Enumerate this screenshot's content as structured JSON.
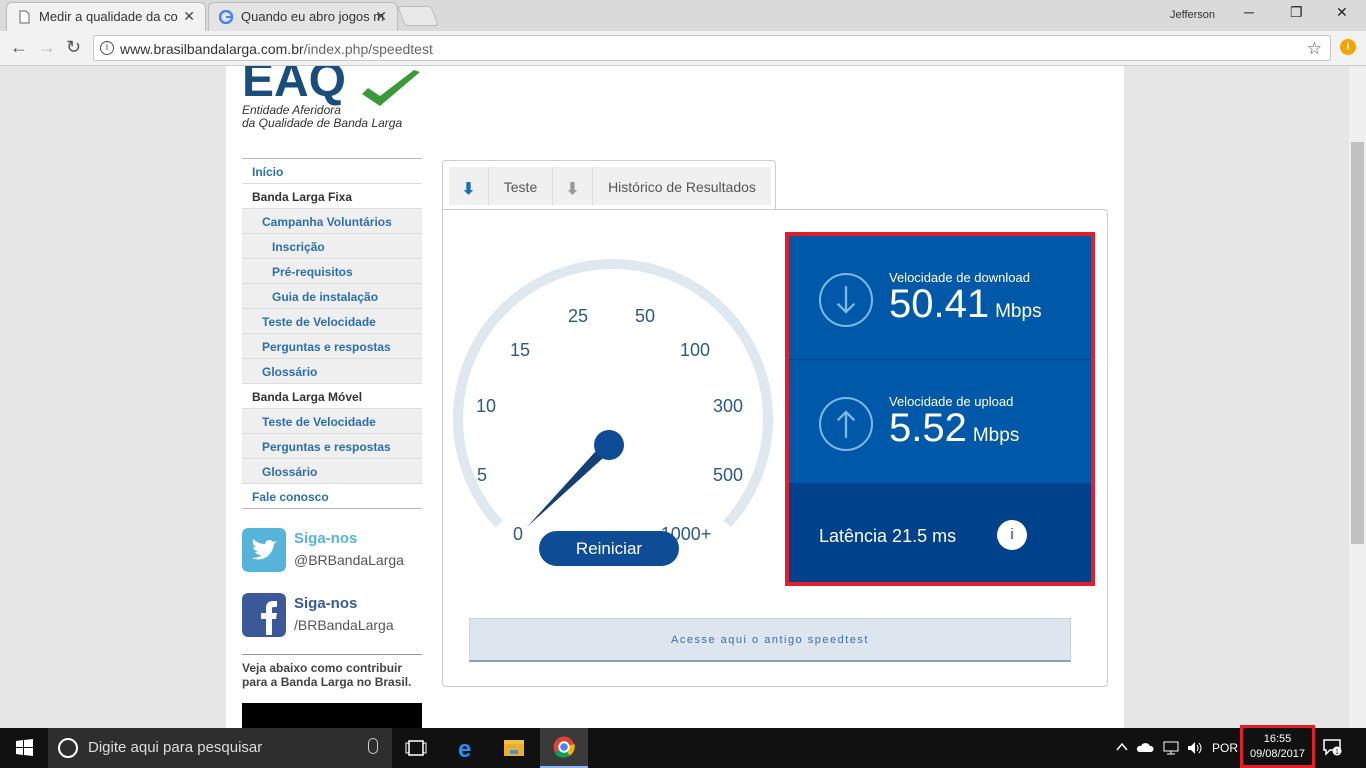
{
  "browser": {
    "tabs": [
      {
        "title": "Medir a qualidade da co",
        "icon": "page-icon"
      },
      {
        "title": "Quando eu abro jogos m",
        "icon": "google-icon"
      }
    ],
    "profile_name": "Jefferson",
    "url_domain": "www.brasilbandalarga.com.br",
    "url_path": "/index.php/speedtest",
    "close_glyph": "✕",
    "back_glyph": "←",
    "forward_glyph": "→",
    "reload_glyph": "↻",
    "star_glyph": "☆",
    "alert_glyph": "!",
    "minimize_glyph": "─",
    "restore_glyph": "❐",
    "info_glyph": "i"
  },
  "site": {
    "logo_text": "EAQ",
    "logo_subtitle_1": "Entidade Aferidora",
    "logo_subtitle_2": "da Qualidade de Banda Larga",
    "menu": [
      {
        "label": "Início",
        "level": 1
      },
      {
        "label": "Banda Larga Fixa",
        "level": 1,
        "header": true
      },
      {
        "label": "Campanha Voluntários",
        "level": 2
      },
      {
        "label": "Inscrição",
        "level": 3
      },
      {
        "label": "Pré-requisitos",
        "level": 3
      },
      {
        "label": "Guia de instalação",
        "level": 3
      },
      {
        "label": "Teste de Velocidade",
        "level": 2
      },
      {
        "label": "Perguntas e respostas",
        "level": 2
      },
      {
        "label": "Glossário",
        "level": 2
      },
      {
        "label": "Banda Larga Móvel",
        "level": 1,
        "header": true
      },
      {
        "label": "Teste de Velocidade",
        "level": 2
      },
      {
        "label": "Perguntas e respostas",
        "level": 2
      },
      {
        "label": "Glossário",
        "level": 2
      },
      {
        "label": "Fale conosco",
        "level": 1
      }
    ],
    "social": {
      "twitter": {
        "title": "Siga-nos",
        "handle": "@BRBandaLarga",
        "icon": "twitter-icon",
        "color": "#56b3d9"
      },
      "facebook": {
        "title": "Siga-nos",
        "handle": "/BRBandaLarga",
        "icon": "facebook-icon",
        "color": "#3b5998"
      }
    },
    "contrib_text": "Veja abaixo como contribuir para a Banda Larga no Brasil."
  },
  "speedtest": {
    "tabs": [
      {
        "label": "Teste",
        "icon": "download-arrow-icon"
      },
      {
        "label": "Histórico de Resultados",
        "icon": "download-arrow-icon"
      }
    ],
    "arrow_glyph": "⬇",
    "gauge_labels": [
      "0",
      "5",
      "10",
      "15",
      "25",
      "50",
      "100",
      "300",
      "500",
      "1000+"
    ],
    "needle_value": "0",
    "restart_label": "Reiniciar",
    "download": {
      "label": "Velocidade de download",
      "value": "50.41",
      "unit": "Mbps",
      "icon": "arrow-down-circle-icon"
    },
    "upload": {
      "label": "Velocidade de upload",
      "value": "5.52",
      "unit": "Mbps",
      "icon": "arrow-up-circle-icon"
    },
    "latency": {
      "label": "Latência 21.5 ms",
      "info_glyph": "i"
    },
    "old_link": "Acesse aqui o antigo speedtest",
    "colors": {
      "dark_blue": "#00418c",
      "mid_blue": "#0058a8",
      "accent": "#0f4c96",
      "highlight": "#e01f2a"
    }
  },
  "taskbar": {
    "search_placeholder": "Digite aqui para pesquisar",
    "language": "POR",
    "time": "16:55",
    "date": "09/08/2017",
    "notification_count": "1"
  }
}
